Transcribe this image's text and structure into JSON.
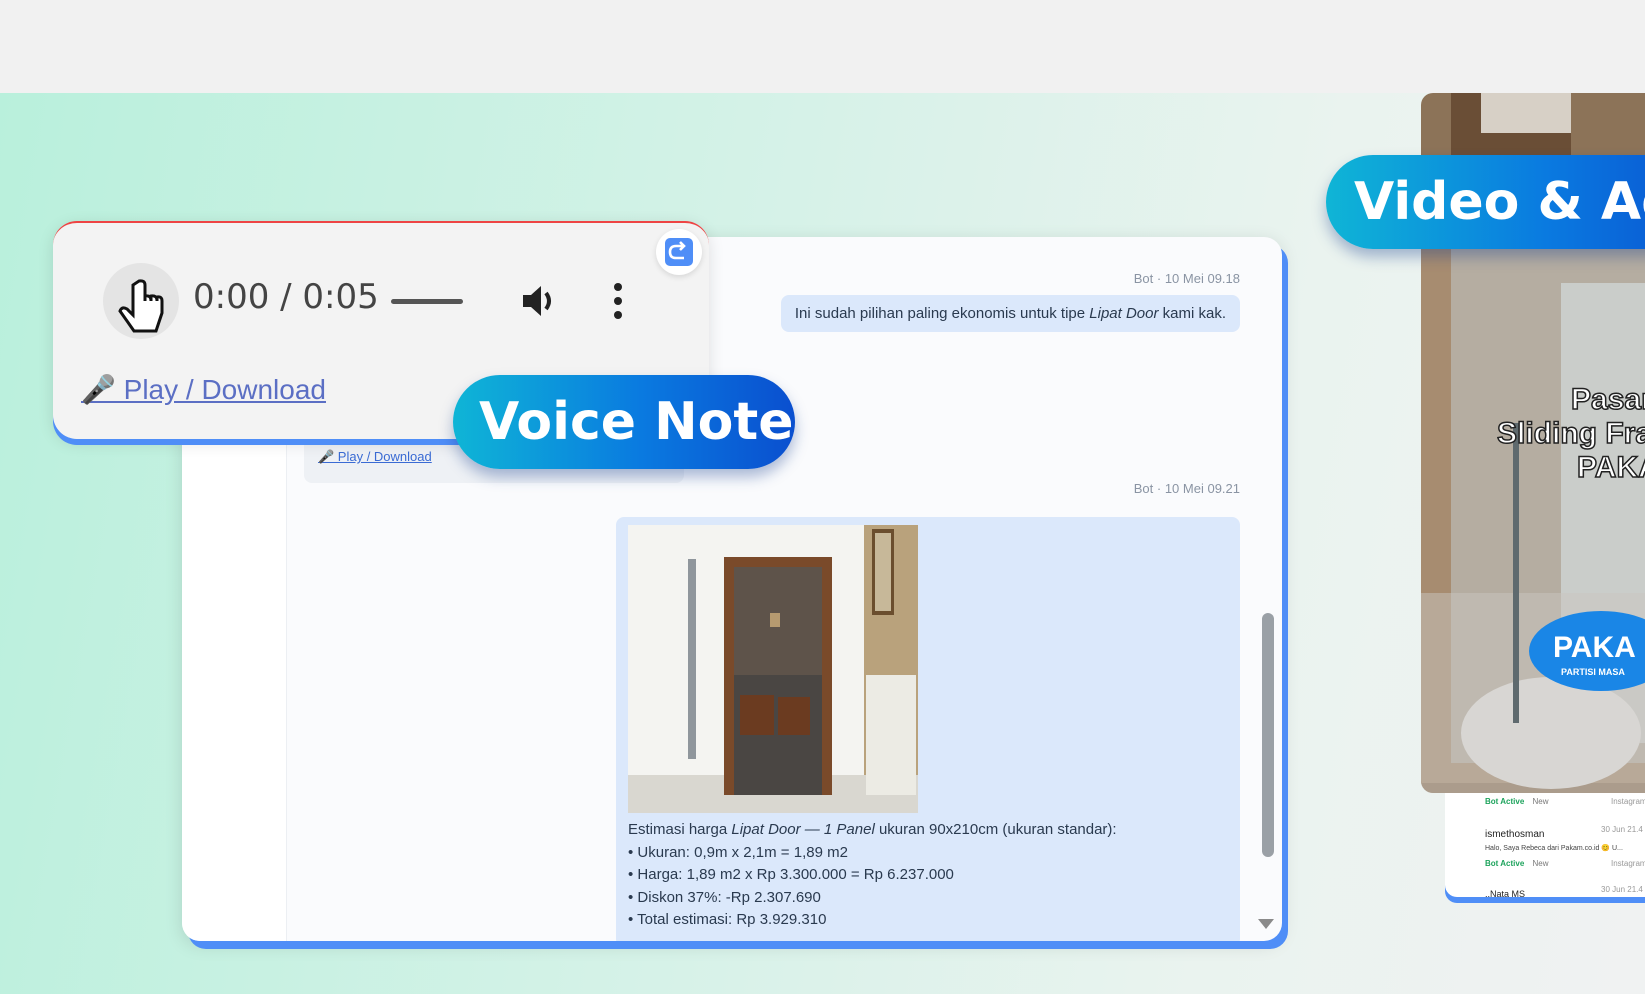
{
  "chat": {
    "msg1": {
      "meta": "Bot · 10 Mei 09.18",
      "text_pre": "Ini sudah pilihan paling ekonomis untuk tipe ",
      "text_em": "Lipat Door",
      "text_post": " kami kak."
    },
    "voice_link": "🎤 Play / Download",
    "msg2": {
      "meta": "Bot · 10 Mei 09.21",
      "line1_pre": "Estimasi harga ",
      "line1_em": "Lipat Door — 1 Panel",
      "line1_post": " ukuran 90x210cm (ukuran standar):",
      "bullets": [
        "• Ukuran: 0,9m x 2,1m = 1,89 m2",
        "• Harga: 1,89 m2 x Rp 3.300.000 = Rp 6.237.000",
        "• Diskon 37%: -Rp 2.307.690",
        "• Total estimasi: Rp 3.929.310"
      ]
    }
  },
  "player": {
    "time": "0:00 / 0:05",
    "link": "🎤 Play / Download"
  },
  "labels": {
    "voice_note": "Voice Note",
    "video_ad": "Video & Ad"
  },
  "video": {
    "caption_1": "Pasan",
    "caption_2": "Sliding Frame",
    "caption_3": "PAKA",
    "brand": "PAKA",
    "brand_sub": "PARTISI MASA"
  },
  "instagram_list": {
    "row1": {
      "status": "Bot Active",
      "tag": "New",
      "source": "Instagram"
    },
    "row2": {
      "name": "ismethosman",
      "time": "30 Jun 21.4",
      "preview": "Halo, Saya Rebeca dari Pakam.co.id 😊 U...",
      "status": "Bot Active",
      "tag": "New",
      "source": "Instagram"
    },
    "row3": {
      "name": "..Nata MS",
      "time": "30 Jun 21.4"
    }
  },
  "colors": {
    "accent": "#4f8ef7",
    "bubble": "#dbe8fb",
    "pill_start": "#0fb5d6",
    "pill_end": "#0a4fcf"
  }
}
